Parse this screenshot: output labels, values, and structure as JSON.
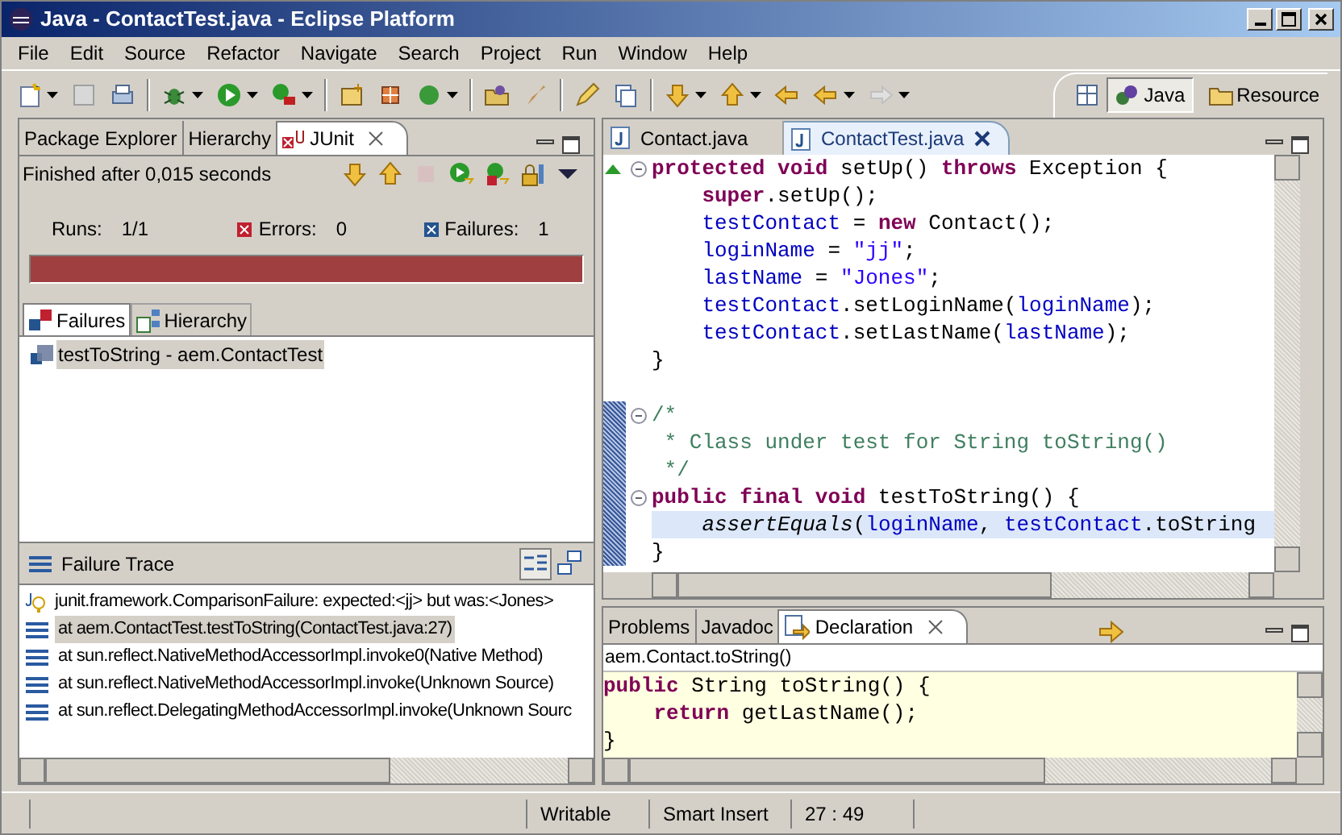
{
  "window": {
    "title": "Java - ContactTest.java - Eclipse Platform"
  },
  "menu": [
    "File",
    "Edit",
    "Source",
    "Refactor",
    "Navigate",
    "Search",
    "Project",
    "Run",
    "Window",
    "Help"
  ],
  "perspectives": [
    {
      "label": "Java",
      "selected": true
    },
    {
      "label": "Resource",
      "selected": false
    }
  ],
  "left_tabs": [
    {
      "label": "Package Explorer",
      "selected": false
    },
    {
      "label": "Hierarchy",
      "selected": false
    },
    {
      "label": "JUnit",
      "selected": true
    }
  ],
  "junit": {
    "status": "Finished after 0,015 seconds",
    "counters": [
      {
        "label": "Runs:",
        "value": "1/1",
        "kind": "runs"
      },
      {
        "label": "Errors:",
        "value": "0",
        "kind": "errors"
      },
      {
        "label": "Failures:",
        "value": "1",
        "kind": "failures"
      }
    ],
    "progress": {
      "level": 1,
      "failed": true
    },
    "sub_tabs": [
      {
        "label": "Failures",
        "selected": true
      },
      {
        "label": "Hierarchy",
        "selected": false
      }
    ],
    "failures": [
      {
        "label": "testToString - aem.ContactTest",
        "selected": true
      }
    ],
    "trace_title": "Failure Trace",
    "trace": [
      {
        "text": "junit.framework.ComparisonFailure: expected:<jj> but was:<Jones>",
        "kind": "message",
        "selected": false
      },
      {
        "text": "at aem.ContactTest.testToString(ContactTest.java:27)",
        "kind": "frame",
        "selected": true
      },
      {
        "text": "at sun.reflect.NativeMethodAccessorImpl.invoke0(Native Method)",
        "kind": "frame",
        "selected": false
      },
      {
        "text": "at sun.reflect.NativeMethodAccessorImpl.invoke(Unknown Source)",
        "kind": "frame",
        "selected": false
      },
      {
        "text": "at sun.reflect.DelegatingMethodAccessorImpl.invoke(Unknown Sourc",
        "kind": "frame",
        "selected": false
      }
    ]
  },
  "editor_tabs": [
    {
      "label": "Contact.java",
      "selected": false
    },
    {
      "label": "ContactTest.java",
      "selected": true
    }
  ],
  "code": [
    {
      "indented": false,
      "highlighted": false,
      "tokens": [
        {
          "kind": "keyword",
          "text": "protected void"
        },
        {
          "kind": "plain",
          "text": " setUp() "
        },
        {
          "kind": "keyword",
          "text": "throws"
        },
        {
          "kind": "plain",
          "text": " Exception {"
        }
      ]
    },
    {
      "indented": true,
      "highlighted": false,
      "tokens": [
        {
          "kind": "keyword",
          "text": "super"
        },
        {
          "kind": "plain",
          "text": ".setUp();"
        }
      ]
    },
    {
      "indented": true,
      "highlighted": false,
      "tokens": [
        {
          "kind": "field",
          "text": "testContact"
        },
        {
          "kind": "plain",
          "text": " = "
        },
        {
          "kind": "keyword",
          "text": "new"
        },
        {
          "kind": "plain",
          "text": " Contact();"
        }
      ]
    },
    {
      "indented": true,
      "highlighted": false,
      "tokens": [
        {
          "kind": "field",
          "text": "loginName"
        },
        {
          "kind": "plain",
          "text": " = "
        },
        {
          "kind": "string",
          "text": "\"jj\""
        },
        {
          "kind": "plain",
          "text": ";"
        }
      ]
    },
    {
      "indented": true,
      "highlighted": false,
      "tokens": [
        {
          "kind": "field",
          "text": "lastName"
        },
        {
          "kind": "plain",
          "text": " = "
        },
        {
          "kind": "string",
          "text": "\"Jones\""
        },
        {
          "kind": "plain",
          "text": ";"
        }
      ]
    },
    {
      "indented": true,
      "highlighted": false,
      "tokens": [
        {
          "kind": "field",
          "text": "testContact"
        },
        {
          "kind": "plain",
          "text": ".setLoginName("
        },
        {
          "kind": "field",
          "text": "loginName"
        },
        {
          "kind": "plain",
          "text": ");"
        }
      ]
    },
    {
      "indented": true,
      "highlighted": false,
      "tokens": [
        {
          "kind": "field",
          "text": "testContact"
        },
        {
          "kind": "plain",
          "text": ".setLastName("
        },
        {
          "kind": "field",
          "text": "lastName"
        },
        {
          "kind": "plain",
          "text": ");"
        }
      ]
    },
    {
      "indented": false,
      "highlighted": false,
      "tokens": [
        {
          "kind": "plain",
          "text": "}"
        }
      ]
    },
    {
      "highlighted": false
    },
    {
      "indented": false,
      "highlighted": false,
      "tokens": [
        {
          "kind": "comment",
          "text": "/*"
        }
      ]
    },
    {
      "indented": false,
      "highlighted": false,
      "tokens": [
        {
          "kind": "comment",
          "text": " * Class under test for String toString()"
        }
      ]
    },
    {
      "indented": false,
      "highlighted": false,
      "tokens": [
        {
          "kind": "comment",
          "text": " */"
        }
      ]
    },
    {
      "indented": false,
      "highlighted": false,
      "tokens": [
        {
          "kind": "keyword",
          "text": "public final void"
        },
        {
          "kind": "plain",
          "text": " testToString() {"
        }
      ]
    },
    {
      "indented": true,
      "highlighted": true,
      "tokens": [
        {
          "kind": "static",
          "text": "assertEquals"
        },
        {
          "kind": "plain",
          "text": "("
        },
        {
          "kind": "field",
          "text": "loginName"
        },
        {
          "kind": "plain",
          "text": ", "
        },
        {
          "kind": "field",
          "text": "testContact"
        },
        {
          "kind": "plain",
          "text": ".toString"
        }
      ]
    },
    {
      "indented": false,
      "highlighted": false,
      "tokens": [
        {
          "kind": "plain",
          "text": "}"
        }
      ]
    }
  ],
  "bottom_tabs": [
    {
      "label": "Problems",
      "selected": false
    },
    {
      "label": "Javadoc",
      "selected": false
    },
    {
      "label": "Declaration",
      "selected": true
    }
  ],
  "declaration": {
    "path": "aem.Contact.toString()",
    "code": [
      {
        "indented": false,
        "tokens": [
          {
            "kind": "keyword",
            "text": "public"
          },
          {
            "kind": "plain",
            "text": " String toString() {"
          }
        ]
      },
      {
        "indented": true,
        "tokens": [
          {
            "kind": "keyword",
            "text": "return"
          },
          {
            "kind": "plain",
            "text": " getLastName();"
          }
        ]
      },
      {
        "indented": false,
        "tokens": [
          {
            "kind": "plain",
            "text": "}"
          }
        ]
      }
    ]
  },
  "status_bar": [
    "Writable",
    "Smart Insert",
    "27 : 49"
  ]
}
